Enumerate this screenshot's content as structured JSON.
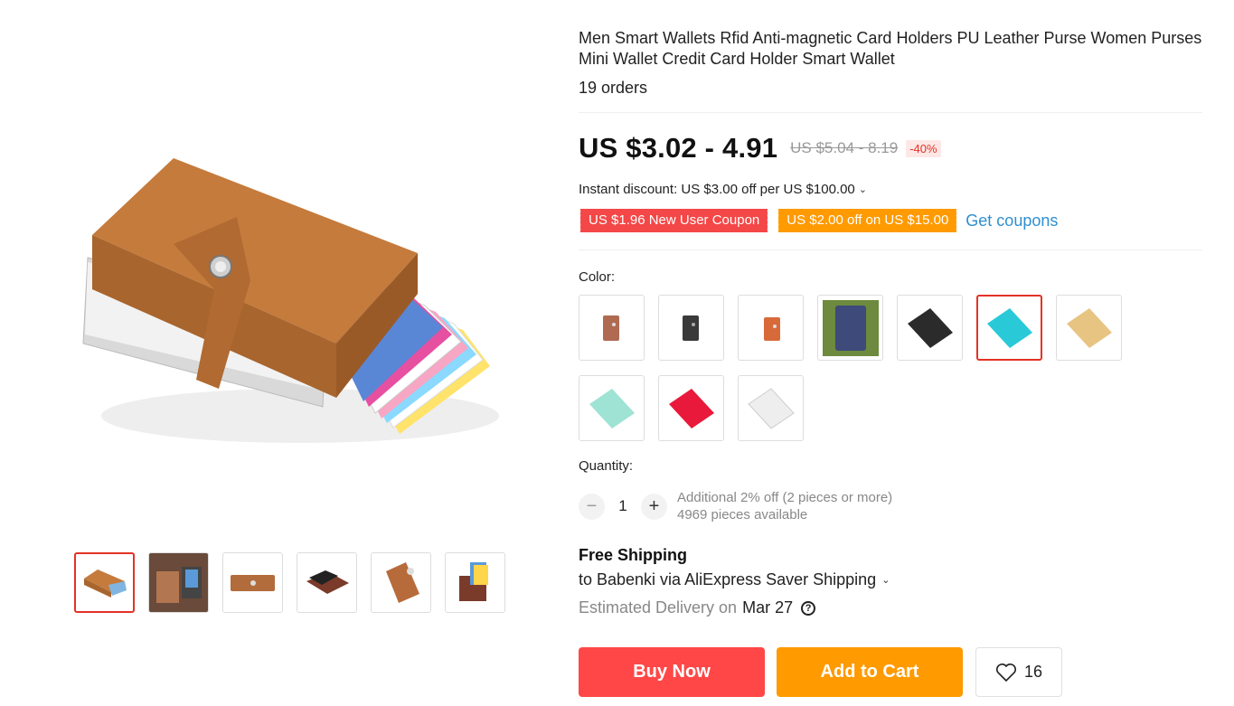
{
  "product": {
    "title": "Men Smart Wallets Rfid Anti-magnetic Card Holders PU Leather Purse Women Purses Mini Wallet Credit Card Holder Smart Wallet",
    "orders": "19 orders"
  },
  "price": {
    "current": "US $3.02 - 4.91",
    "original": "US $5.04 - 8.19",
    "discount": "-40%",
    "instant_discount": "Instant discount: US $3.00 off per US $100.00"
  },
  "coupons": {
    "new_user": "US $1.96 New User Coupon",
    "store": "US $2.00 off on US $15.00",
    "get_label": "Get coupons"
  },
  "color": {
    "label": "Color:",
    "options": [
      {
        "name": "brown-small",
        "color": "#b06a52"
      },
      {
        "name": "black-small",
        "color": "#3a3a3a"
      },
      {
        "name": "orange-small",
        "color": "#d86a3a"
      },
      {
        "name": "navy-photo",
        "color": "#3d4a7a"
      },
      {
        "name": "black",
        "color": "#2b2b2b"
      },
      {
        "name": "sky-blue",
        "color": "#29c9d8"
      },
      {
        "name": "gold",
        "color": "#e8c483"
      },
      {
        "name": "mint",
        "color": "#9ee3d3"
      },
      {
        "name": "red",
        "color": "#e8193a"
      },
      {
        "name": "silver",
        "color": "#e6e6e6"
      }
    ],
    "selected_index": 5
  },
  "quantity": {
    "label": "Quantity:",
    "value": "1",
    "note_discount": "Additional 2% off (2 pieces or more)",
    "note_available": "4969 pieces available"
  },
  "shipping": {
    "title": "Free Shipping",
    "to": "to Babenki via AliExpress Saver Shipping",
    "est_label": "Estimated Delivery on",
    "est_date": "Mar 27"
  },
  "actions": {
    "buy": "Buy Now",
    "cart": "Add to Cart",
    "wish_count": "16"
  },
  "icons": {
    "chevron": "chevron-down-icon",
    "help": "help-circle-icon",
    "heart": "heart-icon",
    "minus": "minus-icon",
    "plus": "plus-icon"
  },
  "colors": {
    "accent_red": "#ff4747",
    "accent_orange": "#ff9a00",
    "link_blue": "#2e8fd0"
  }
}
